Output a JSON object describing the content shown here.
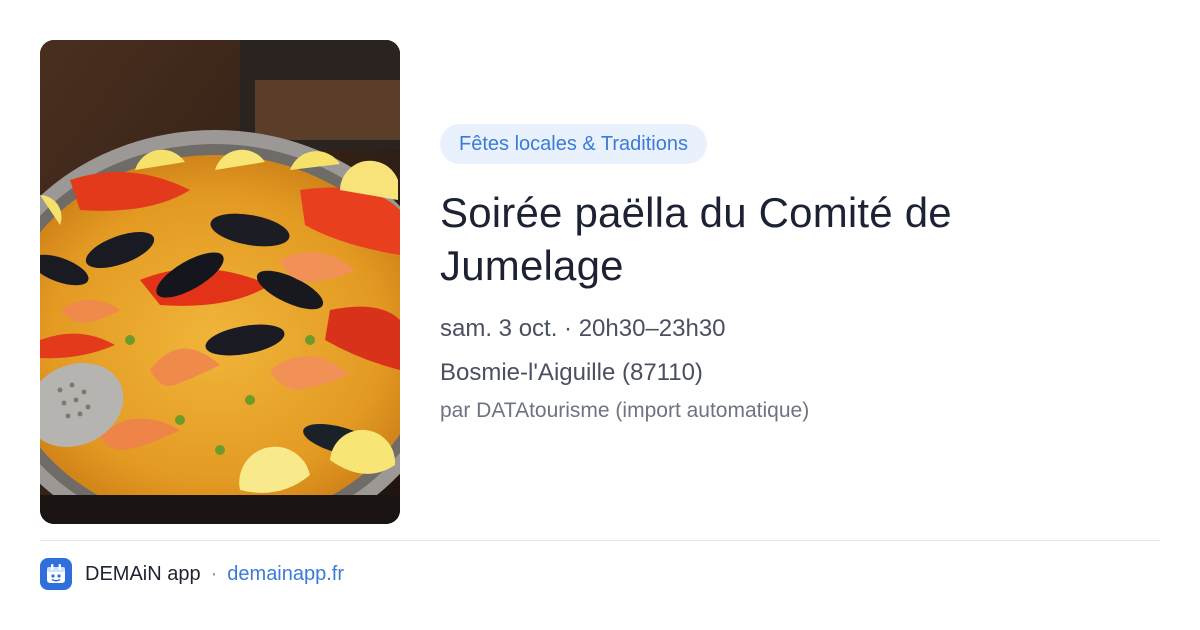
{
  "event": {
    "image_alt": "Paëlla aux fruits de mer",
    "category": "Fêtes locales & Traditions",
    "title": "Soirée paëlla du Comité de Jumelage",
    "date_time": "sam. 3 oct. · 20h30–23h30",
    "location": "Bosmie-l'Aiguille (87110)",
    "source": "par DATAtourisme (import automatique)"
  },
  "footer": {
    "app_icon": "calendar-app-icon",
    "app_name": "DEMAiN app",
    "separator": "·",
    "url": "demainapp.fr"
  },
  "colors": {
    "accent": "#3b7bd8",
    "badge_bg": "#e9f1fc",
    "title": "#1c2233",
    "muted": "#6d7382",
    "app_icon_bg": "#2f6fdc"
  }
}
